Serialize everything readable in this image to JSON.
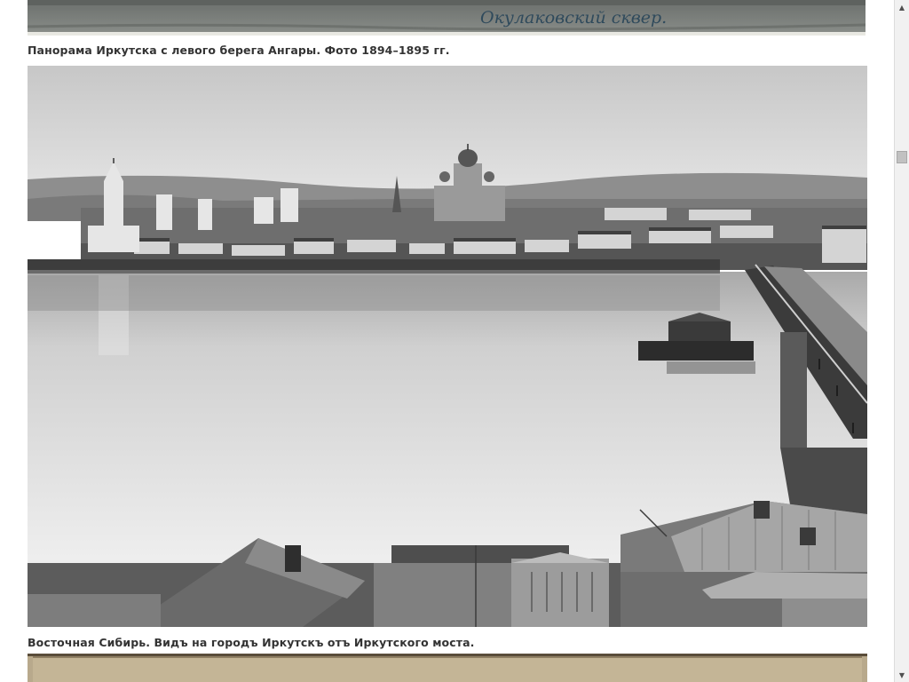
{
  "top_photo": {
    "handwriting": "Окулаковский сквер."
  },
  "captions": [
    "Панорама Иркутска с левого берега Ангары. Фото 1894–1895 гг.",
    "Восточная Сибирь. Видъ на городъ Иркутскъ отъ Иркутского моста."
  ],
  "scrollbar": {
    "up_icon": "▲",
    "down_icon": "▼"
  }
}
